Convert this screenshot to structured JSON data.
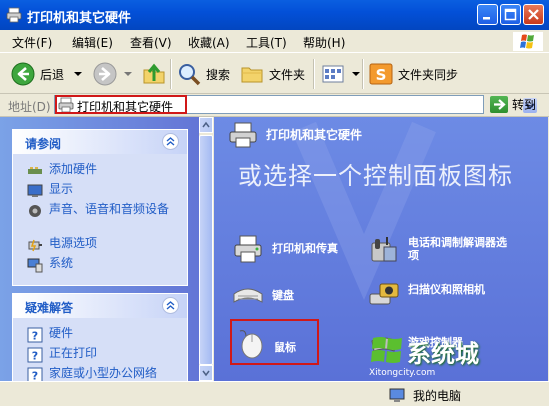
{
  "window": {
    "title": "打印机和其它硬件"
  },
  "menubar": {
    "items": [
      "文件(F)",
      "编辑(E)",
      "查看(V)",
      "收藏(A)",
      "工具(T)",
      "帮助(H)"
    ]
  },
  "toolbar": {
    "back_label": "后退",
    "search_label": "搜索",
    "folders_label": "文件夹",
    "sync_label": "文件夹同步"
  },
  "address": {
    "label": "地址(D)",
    "value": "打印机和其它硬件",
    "go_label": "转到"
  },
  "see_also": {
    "title": "请参阅",
    "items": [
      {
        "label": "添加硬件",
        "icon": "add-hardware-icon"
      },
      {
        "label": "显示",
        "icon": "display-icon"
      },
      {
        "label": "声音、语音和音频设备",
        "icon": "sound-icon"
      },
      {
        "label": "电源选项",
        "icon": "power-icon"
      },
      {
        "label": "系统",
        "icon": "system-icon"
      }
    ]
  },
  "troubleshoot": {
    "title": "疑难解答",
    "items": [
      {
        "label": "硬件",
        "icon": "help-icon"
      },
      {
        "label": "正在打印",
        "icon": "help-icon"
      },
      {
        "label": "家庭或小型办公网络",
        "icon": "help-icon"
      }
    ]
  },
  "content": {
    "header": "打印机和其它硬件",
    "heading": "或选择一个控制面板图标",
    "icons": [
      {
        "label": "打印机和传真",
        "icon": "printer-fax-icon"
      },
      {
        "label": "电话和调制解调器选项",
        "icon": "phone-modem-icon"
      },
      {
        "label": "键盘",
        "icon": "keyboard-icon"
      },
      {
        "label": "扫描仪和照相机",
        "icon": "scanner-camera-icon"
      },
      {
        "label": "鼠标",
        "icon": "mouse-icon"
      },
      {
        "label": "游戏控制器",
        "icon": "game-controller-icon"
      }
    ]
  },
  "statusbar": {
    "location": "我的电脑"
  },
  "watermark": {
    "text": "系统城",
    "url": "Xitongcity.com"
  },
  "colors": {
    "titlebar": "#0350D8",
    "left_pane": "#6D8BE5",
    "link": "#215DC6",
    "highlight": "#D01818"
  }
}
